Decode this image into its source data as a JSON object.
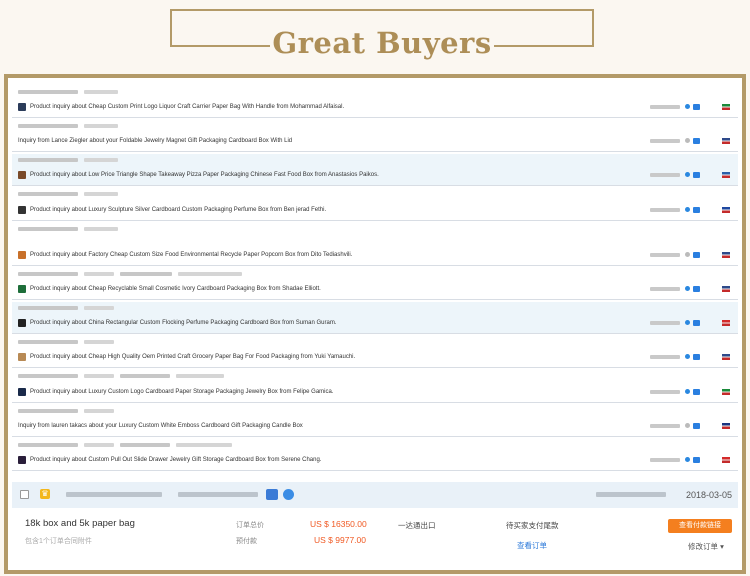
{
  "header": {
    "title": "Great Buyers"
  },
  "inquiries": [
    {
      "text": "Product inquiry about Cheap Custom Print Logo Liquor Craft Carrier Paper Bag With Handle from Mohammad Alfaisal.",
      "icon": "product-thumbnail",
      "flag": "ae-flag",
      "highlight": false
    },
    {
      "text": "Inquiry from Lance Ziegler about your Foldable Jewelry Magnet Gift Packaging Cardboard Box With Lid",
      "icon": "",
      "flag": "us-flag",
      "highlight": false
    },
    {
      "text": "Product inquiry about Low Price Triangle Shape Takeaway Pizza Paper Packaging Chinese Fast Food Box from Anastasios Paikos.",
      "icon": "product-thumbnail",
      "flag": "se-flag",
      "highlight": true
    },
    {
      "text": "Product inquiry about Luxury Sculpture Silver Cardboard Custom Packaging Perfume Box from Ben jerad Fethi.",
      "icon": "product-thumbnail",
      "flag": "fr-flag",
      "highlight": false
    },
    {
      "text": "Product inquiry about Factory Cheap Custom Size Food Environmental Recycle Paper Popcorn Box from Dito Tediashvili.",
      "icon": "product-thumbnail",
      "flag": "us-flag",
      "highlight": false
    },
    {
      "text": "Product inquiry about Cheap Recyclable Small Cosmetic Ivory Cardboard Packaging Box from Shadae Elliott.",
      "icon": "product-thumbnail",
      "flag": "us-flag",
      "highlight": false
    },
    {
      "text": "Product inquiry about China Rectangular Custom Flocking Perfume Packaging Cardboard Box from Suman Guram.",
      "icon": "product-thumbnail",
      "flag": "ca-flag",
      "highlight": true
    },
    {
      "text": "Product inquiry about Cheap High Quality Oem Printed Craft Grocery Paper Bag For Food Packaging from Yuki Yamauchi.",
      "icon": "product-thumbnail",
      "flag": "us-flag",
      "highlight": false
    },
    {
      "text": "Product inquiry about Luxury Custom Logo Cardboard Paper Storage Packaging Jewelry Box from Felipe Gamica.",
      "icon": "product-thumbnail",
      "flag": "ae-flag",
      "highlight": false
    },
    {
      "text": "Inquiry from lauren takacs about your Luxury Custom White Emboss Cardboard Gift Packaging Candle Box",
      "icon": "",
      "flag": "au-flag",
      "highlight": false
    },
    {
      "text": "Product inquiry about Custom Pull Out Slide Drawer Jewelry Gift Storage Cardboard Box from Serene Chang.",
      "icon": "product-thumbnail",
      "flag": "ca-flag",
      "highlight": false
    }
  ],
  "order": {
    "date": "2018-03-05",
    "product": "18k box and 5k paper bag",
    "sub": "包含1个订单合同附件",
    "total_label": "订单总价",
    "total_value": "US $ 16350.00",
    "prepay_label": "预付款",
    "prepay_value": "US $ 9977.00",
    "shipping_status": "一达通出口",
    "payment_status": "待买家支付尾款",
    "view_order": "查看订单",
    "button": "查看付款链接",
    "more": "修改订单 ▾"
  },
  "colors": {
    "gold": "#b39a68",
    "title": "#ad8e57",
    "highlight_row": "#edf5fa",
    "price": "#f05a24",
    "accent_button": "#f47f1f",
    "link": "#2d7ad9"
  }
}
